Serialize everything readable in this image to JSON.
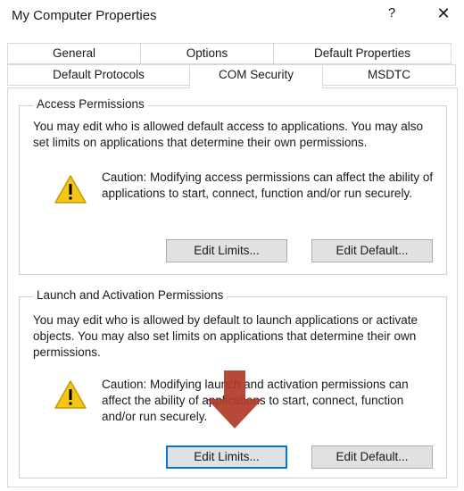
{
  "window": {
    "title": "My Computer Properties",
    "help_label": "?",
    "close_label": "✕"
  },
  "tabs": {
    "row1": [
      "General",
      "Options",
      "Default Properties"
    ],
    "row2": [
      "Default Protocols",
      "COM Security",
      "MSDTC"
    ],
    "active": "COM Security"
  },
  "access": {
    "title": "Access Permissions",
    "description": "You may edit who is allowed default access to applications. You may also set limits on applications that determine their own permissions.",
    "caution": "Caution: Modifying access permissions can affect the ability of applications to start, connect, function and/or run securely.",
    "edit_limits": "Edit Limits...",
    "edit_default": "Edit Default..."
  },
  "launch": {
    "title": "Launch and Activation Permissions",
    "description": "You may edit who is allowed by default to launch applications or activate objects. You may also set limits on applications that determine their own permissions.",
    "caution": "Caution: Modifying launch and activation permissions can affect the ability of applications to start, connect, function and/or run securely.",
    "edit_limits": "Edit Limits...",
    "edit_default": "Edit Default..."
  },
  "colors": {
    "arrow": "#b03a26",
    "warning_fill": "#f5c518",
    "focus_border": "#0078d7"
  },
  "icons": {
    "warning": "warning-triangle-icon",
    "annotation": "down-arrow-annotation"
  }
}
